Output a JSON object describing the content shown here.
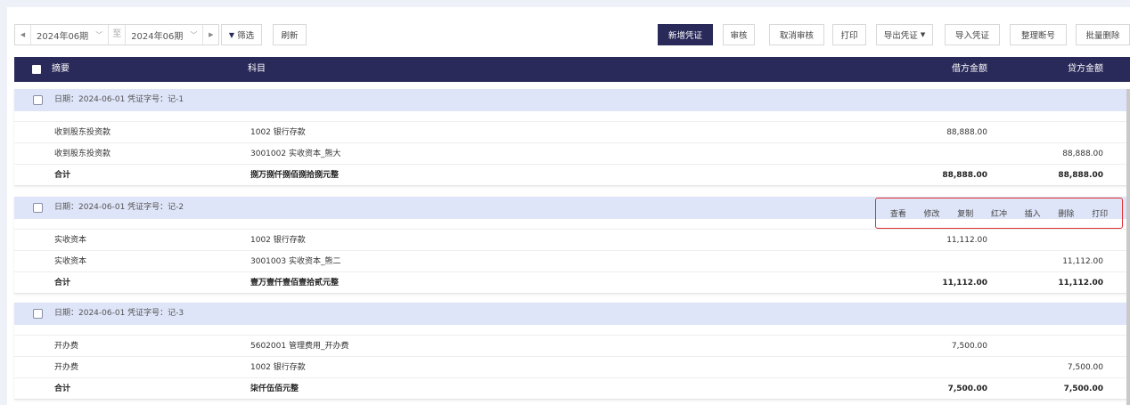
{
  "toolbar": {
    "period_start": "2024年06期",
    "period_to": "至",
    "period_end": "2024年06期",
    "filter_label": "筛选",
    "refresh_label": "刷新",
    "buttons": {
      "new_voucher": "新增凭证",
      "audit": "审核",
      "cancel_audit": "取消审核",
      "print": "打印",
      "export": "导出凭证",
      "import": "导入凭证",
      "reorder": "整理断号",
      "batch_delete": "批量删除"
    }
  },
  "table_header": {
    "summary": "摘要",
    "account": "科目",
    "debit": "借方金额",
    "credit": "贷方金额"
  },
  "groups": [
    {
      "info": "日期：2024-06-01 凭证字号：记-1",
      "rows": [
        {
          "summary": "收到股东投资款",
          "account": "1002 银行存款",
          "debit": "88,888.00",
          "credit": ""
        },
        {
          "summary": "收到股东投资款",
          "account": "3001002 实收资本_熊大",
          "debit": "",
          "credit": "88,888.00"
        }
      ],
      "total": {
        "summary": "合计",
        "account": "捌万捌仟捌佰捌拾捌元整",
        "debit": "88,888.00",
        "credit": "88,888.00"
      }
    },
    {
      "info": "日期：2024-06-01 凭证字号：记-2",
      "rows": [
        {
          "summary": "实收资本",
          "account": "1002 银行存款",
          "debit": "11,112.00",
          "credit": ""
        },
        {
          "summary": "实收资本",
          "account": "3001003 实收资本_熊二",
          "debit": "",
          "credit": "11,112.00"
        }
      ],
      "total": {
        "summary": "合计",
        "account": "壹万壹仟壹佰壹拾贰元整",
        "debit": "11,112.00",
        "credit": "11,112.00"
      }
    },
    {
      "info": "日期：2024-06-01 凭证字号：记-3",
      "rows": [
        {
          "summary": "开办费",
          "account": "5602001 管理费用_开办费",
          "debit": "7,500.00",
          "credit": ""
        },
        {
          "summary": "开办费",
          "account": "1002 银行存款",
          "debit": "",
          "credit": "7,500.00"
        }
      ],
      "total": {
        "summary": "合计",
        "account": "柒仟伍佰元整",
        "debit": "7,500.00",
        "credit": "7,500.00"
      }
    }
  ],
  "row_actions": {
    "view": "查看",
    "edit": "修改",
    "copy": "复制",
    "red_reverse": "红冲",
    "insert": "插入",
    "delete": "删除",
    "print": "打印"
  },
  "colors": {
    "primary": "#2a2a5a",
    "group_header_bg": "#dfe5f8",
    "highlight_border": "#e03030",
    "page_bg": "#eef1f8"
  }
}
